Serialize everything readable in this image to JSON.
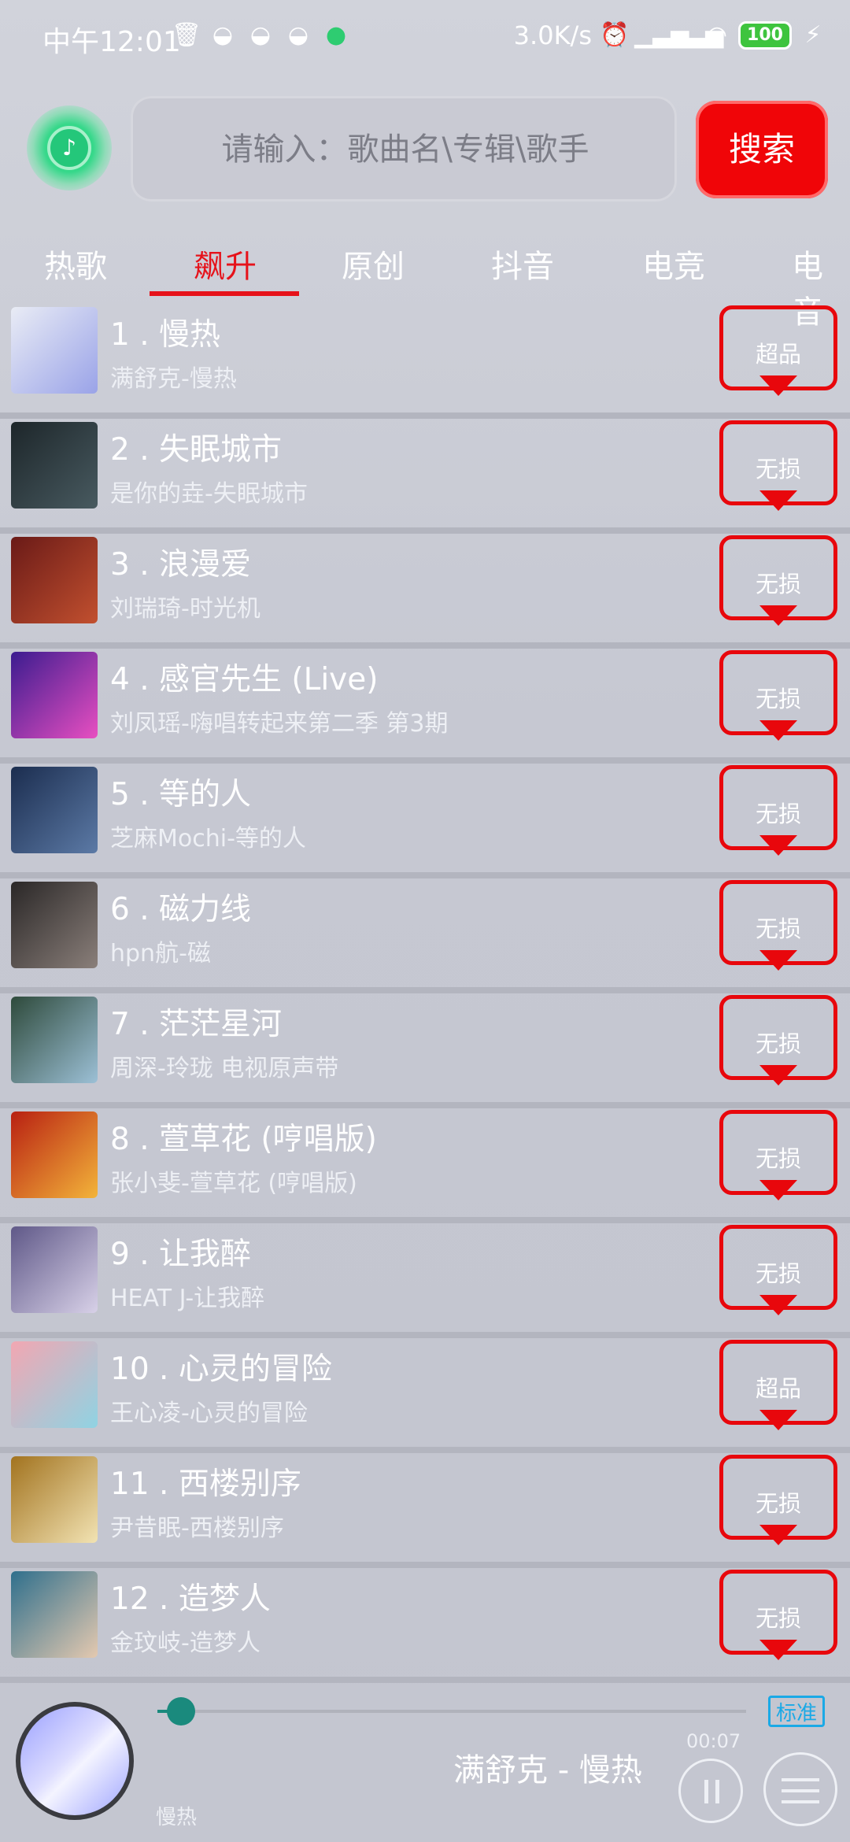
{
  "status_bar": {
    "time": "中午12:01",
    "speed": "3.0K/s",
    "battery": "100",
    "icons": [
      "trash-icon",
      "android-icon",
      "android-icon",
      "android-icon",
      "app-dot-icon"
    ],
    "right_icons": [
      "alarm-icon",
      "signal-hd-icon",
      "signal-hd-icon",
      "wifi-icon",
      "battery-icon",
      "charging-icon"
    ]
  },
  "header": {
    "search_placeholder": "请输入：歌曲名\\专辑\\歌手",
    "search_button": "搜索"
  },
  "tabs": [
    {
      "label": "热歌",
      "active": false
    },
    {
      "label": "飙升",
      "active": true
    },
    {
      "label": "原创",
      "active": false
    },
    {
      "label": "抖音",
      "active": false
    },
    {
      "label": "电竞",
      "active": false
    },
    {
      "label": "电音",
      "active": false
    }
  ],
  "songs": [
    {
      "title": "1 . 慢热",
      "sub": "满舒克-慢热",
      "quality": "超品",
      "cover": [
        "#e9ecf5",
        "#9aa3e8"
      ]
    },
    {
      "title": "2 . 失眠城市",
      "sub": "是你的垚-失眠城市",
      "quality": "无损",
      "cover": [
        "#1d262a",
        "#485a60"
      ]
    },
    {
      "title": "3 . 浪漫爱",
      "sub": "刘瑞琦-时光机",
      "quality": "无损",
      "cover": [
        "#6a1a17",
        "#c2502f"
      ]
    },
    {
      "title": "4 . 感官先生 (Live)",
      "sub": "刘凤瑶-嗨唱转起来第二季 第3期",
      "quality": "无损",
      "cover": [
        "#3b1c8f",
        "#e84fc1"
      ]
    },
    {
      "title": "5 . 等的人",
      "sub": "芝麻Mochi-等的人",
      "quality": "无损",
      "cover": [
        "#1b2d4f",
        "#5c7aa6"
      ]
    },
    {
      "title": "6 . 磁力线",
      "sub": "hpn航-磁",
      "quality": "无损",
      "cover": [
        "#2a2727",
        "#8a7f7a"
      ]
    },
    {
      "title": "7 . 茫茫星河",
      "sub": "周深-玲珑 电视原声带",
      "quality": "无损",
      "cover": [
        "#2e4a3b",
        "#9cc0d6"
      ]
    },
    {
      "title": "8 . 萱草花 (哼唱版)",
      "sub": "张小斐-萱草花 (哼唱版)",
      "quality": "无损",
      "cover": [
        "#b82012",
        "#f3b43a"
      ]
    },
    {
      "title": "9 . 让我醉",
      "sub": "HEAT J-让我醉",
      "quality": "无损",
      "cover": [
        "#5f5888",
        "#d8d1e8"
      ]
    },
    {
      "title": "10 . 心灵的冒险",
      "sub": "王心凌-心灵的冒险",
      "quality": "超品",
      "cover": [
        "#f2a7b2",
        "#8fd3e3"
      ]
    },
    {
      "title": "11 . 西楼别序",
      "sub": "尹昔眠-西楼别序",
      "quality": "无损",
      "cover": [
        "#a2731f",
        "#f2e3b3"
      ]
    },
    {
      "title": "12 . 造梦人",
      "sub": "金玟岐-造梦人",
      "quality": "无损",
      "cover": [
        "#2f6f8c",
        "#e4c9b0"
      ]
    }
  ],
  "player": {
    "quality": "标准",
    "time": "00:07",
    "now_playing": "满舒克 - 慢热",
    "lyric": "慢热",
    "progress_fraction": 0.03
  }
}
